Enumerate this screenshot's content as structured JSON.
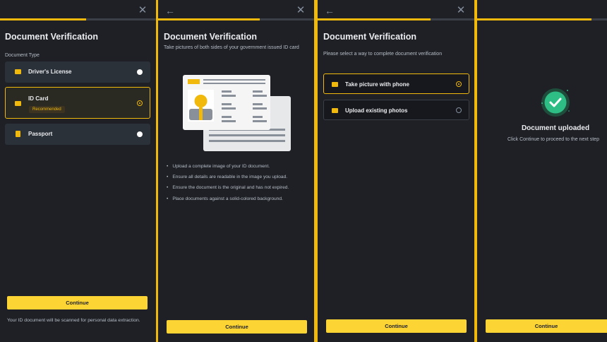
{
  "colors": {
    "accent": "#f0b90b",
    "button": "#fcd535",
    "panel": "#1e2026",
    "card": "#2b3139",
    "success": "#2ebd85"
  },
  "screens": {
    "s1": {
      "progress": 0.55,
      "title": "Document Verification",
      "label": "Document Type",
      "options": [
        {
          "label": "Driver's License",
          "icon": "id-card-icon",
          "selected": false
        },
        {
          "label": "ID Card",
          "badge": "Recommended",
          "icon": "id-card-icon",
          "selected": true
        },
        {
          "label": "Passport",
          "icon": "passport-icon",
          "selected": false
        }
      ],
      "continue": "Continue",
      "note": "Your ID document will be scanned for personal data extraction."
    },
    "s2": {
      "progress": 0.65,
      "title": "Document Verification",
      "subtitle": "Take pictures of both sides of your government issued ID card",
      "bullets": [
        "Upload a complete image of your ID document.",
        "Ensure all details are readable in the image you upload.",
        "Ensure the document is the original and has not expired.",
        "Place documents against a solid-colored background."
      ],
      "continue": "Continue"
    },
    "s3": {
      "progress": 0.72,
      "title": "Document Verification",
      "subtitle": "Please select a way to complete document verification",
      "options": [
        {
          "label": "Take picture with phone",
          "icon": "camera-icon",
          "selected": true
        },
        {
          "label": "Upload existing photos",
          "icon": "upload-icon",
          "selected": false
        }
      ],
      "continue": "Continue"
    },
    "s4": {
      "progress": 0.88,
      "title": "Document uploaded",
      "subtitle": "Click Continue to proceed to the next step",
      "continue": "Continue"
    }
  }
}
